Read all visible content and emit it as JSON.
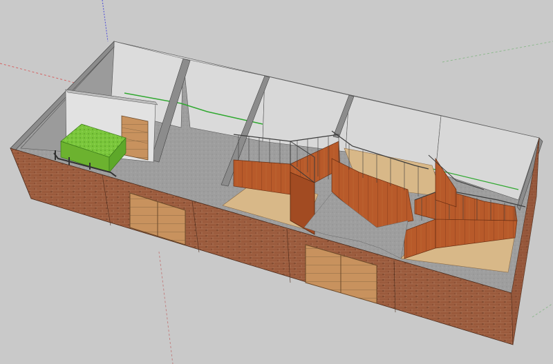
{
  "viewport": {
    "background": "#c9c9c9",
    "axes": {
      "red": "#d84a4a",
      "green": "#2fa82f",
      "blue": "#4a4ad8"
    }
  },
  "model": {
    "subject": "stable-building-3d-model",
    "materials": {
      "brick": "#9a5a3c",
      "brick_dark": "#6e3f2a",
      "mortar": "#b07a5e",
      "floor_concrete": "#9e9e9e",
      "floor_sand": "#d8b888",
      "wall_white": "#dddddd",
      "wall_grey": "#cfcfcf",
      "wall_shadow": "#8c8c8c",
      "timber": "#b85a2a",
      "timber_light": "#c9793e",
      "door_wood": "#c8925e",
      "green_object": "#7ac63b",
      "railing": "#3b3b3b"
    }
  }
}
